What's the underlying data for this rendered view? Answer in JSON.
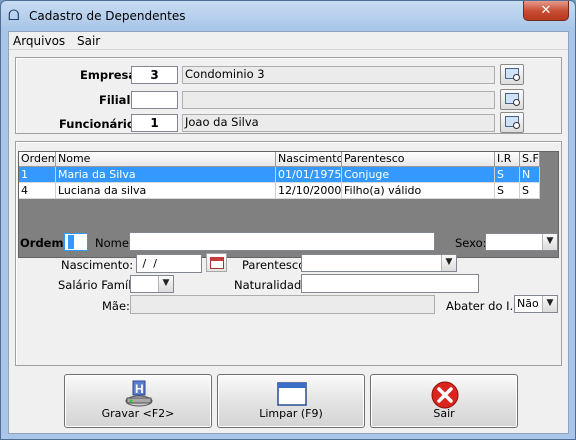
{
  "window": {
    "title": "Cadastro de Dependentes",
    "close_glyph": "✕",
    "icon": "app-icon"
  },
  "menu": {
    "items": [
      "Arquivos",
      "Sair"
    ]
  },
  "header": {
    "empresa": {
      "label": "Empresa:",
      "code": "3",
      "name": "Condominio 3"
    },
    "filial": {
      "label": "Filial:",
      "code": "",
      "name": ""
    },
    "funcionario": {
      "label": "Funcionário:",
      "code": "1",
      "name": "Joao da Silva"
    }
  },
  "grid": {
    "columns": [
      "Ordem",
      "Nome",
      "Nascimento",
      "Parentesco",
      "I.R",
      "S.F"
    ],
    "rows": [
      {
        "ordem": "1",
        "nome": "Maria da Silva",
        "nascimento": "01/01/1975",
        "parentesco": "Conjuge",
        "ir": "S",
        "sf": "N",
        "selected": true
      },
      {
        "ordem": "4",
        "nome": "Luciana da silva",
        "nascimento": "12/10/2000",
        "parentesco": "Filho(a) válido",
        "ir": "S",
        "sf": "S",
        "selected": false
      }
    ]
  },
  "form": {
    "ordem_label": "Ordem:",
    "ordem_value": "",
    "nome_label": "Nome:",
    "nome_value": "",
    "sexo_label": "Sexo:",
    "sexo_value": "",
    "nascimento_label": "Nascimento:",
    "nascimento_value": " /  /",
    "parentesco_label": "Parentesco:",
    "parentesco_value": "",
    "salario_label": "Salário Família:",
    "salario_value": "",
    "naturalidade_label": "Naturalidade:",
    "naturalidade_value": "",
    "mae_label": "Mãe:",
    "mae_value": "",
    "abater_label": "Abater do I.R:",
    "abater_value": "Não"
  },
  "buttons": {
    "gravar": "Gravar <F2>",
    "limpar": "Limpar (F9)",
    "sair": "Sair"
  },
  "colors": {
    "selection": "#3399ff",
    "grid_bg": "#808080",
    "window_frame": "#a9c6e8"
  }
}
